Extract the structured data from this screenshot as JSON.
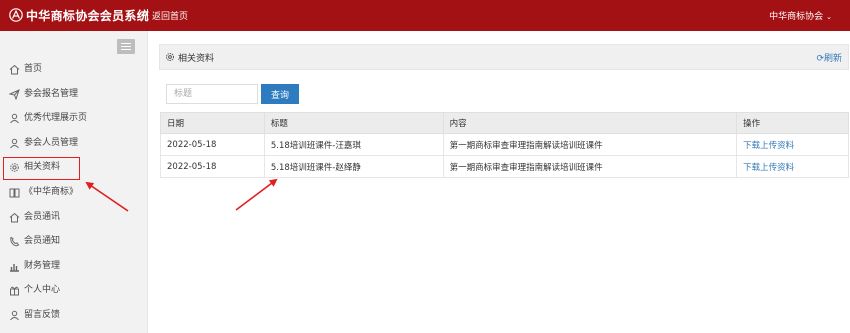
{
  "header": {
    "system_title": "中华商标协会会员系统",
    "back_home": "返回首页",
    "org_name": "中华商标协会",
    "org_caret": "⌄"
  },
  "sidebar": {
    "items": [
      {
        "label": "首页",
        "icon": "home-icon"
      },
      {
        "label": "参会报名管理",
        "icon": "paper-plane-icon"
      },
      {
        "label": "优秀代理展示页",
        "icon": "user-icon"
      },
      {
        "label": "参会人员管理",
        "icon": "user-icon"
      },
      {
        "label": "相关资料",
        "icon": "gear-icon",
        "active": true
      },
      {
        "label": "《中华商标》",
        "icon": "book-icon"
      },
      {
        "label": "会员通讯",
        "icon": "home-icon"
      },
      {
        "label": "会员通知",
        "icon": "phone-icon"
      },
      {
        "label": "财务管理",
        "icon": "bar-chart-icon"
      },
      {
        "label": "个人中心",
        "icon": "gift-icon"
      },
      {
        "label": "留言反馈",
        "icon": "user-icon"
      }
    ]
  },
  "panel": {
    "title": "相关资料",
    "refresh_label": "刷新"
  },
  "search": {
    "placeholder": "标题",
    "button_label": "查询"
  },
  "table": {
    "headers": [
      "日期",
      "标题",
      "内容",
      "操作"
    ],
    "rows": [
      {
        "date": "2022-05-18",
        "title": "5.18培训班课件-汪嘉琪",
        "content": "第一期商标审查审理指南解读培训班课件",
        "action": "下载上传资料"
      },
      {
        "date": "2022-05-18",
        "title": "5.18培训班课件-赵绎静",
        "content": "第一期商标审查审理指南解读培训班课件",
        "action": "下载上传资料"
      }
    ]
  },
  "colors": {
    "header_bg": "#a31114",
    "accent_blue": "#2e7cbf",
    "annotation_red": "#e02020"
  }
}
